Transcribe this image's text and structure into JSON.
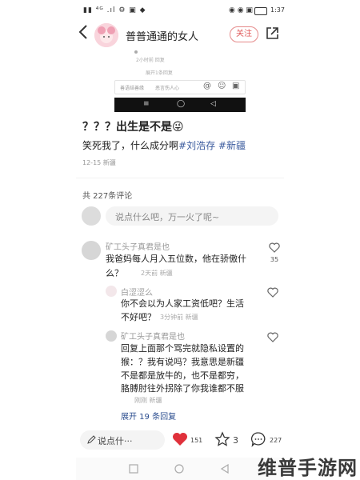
{
  "status_bar": {
    "left_icons": "▮▮ ⁴ᴳ .ıl ⚙ ▣ ◆",
    "right_icons": "◉ ◉ ▣",
    "time": "1:37"
  },
  "header": {
    "back_icon": "chevron-left",
    "username": "普普通通的女人",
    "follow_label": "关注",
    "share_icon": "share-icon"
  },
  "embedded_screenshot": {
    "meta1": "2小时前   回复",
    "meta2": "展开1条回复",
    "input_placeholder1": "善语结善缘",
    "input_placeholder2": "恶言伤人心",
    "input_icons": [
      "@",
      "☺",
      "▣"
    ],
    "nav_icons": [
      "≡",
      "◯",
      "◁"
    ]
  },
  "post": {
    "line1": "？？？出生是不是",
    "line1_emoji": "😜",
    "line2_prefix": "笑死我了，什么成分啊",
    "tags": [
      "#刘浩存",
      "#新疆"
    ],
    "date": "12-15  新疆"
  },
  "comments_count_label": "共 227条评论",
  "say_something": {
    "placeholder": "说点什么吧，万一火了呢~"
  },
  "comments": [
    {
      "name": "矿工头子真君是也",
      "text": "我爸妈每人月入五位数，他在骄傲什么？",
      "text_line2": "么？",
      "meta": "2天前  新疆",
      "likes": "35"
    }
  ],
  "replies": [
    {
      "name": "白涩涩么",
      "text_line1": "你不会以为人家工资低吧？生活",
      "text_line2": "不好吧？",
      "meta": "3分钟前  新疆"
    },
    {
      "name": "矿工头子真君是也",
      "text_line1": "回复上面那个骂完就隐私设置的",
      "text_line2": "猴：？我有说吗？我意思是新疆",
      "text_line3": "不是都是放牛的，也不是都穷，",
      "text_line4": "胳膊肘往外拐除了你我谁都不服",
      "meta": "刚刚  新疆"
    }
  ],
  "expand_label": "展开 19 条回复",
  "bottom_bar": {
    "say_label": "说点什···",
    "likes": "151",
    "stars": "3",
    "comments": "227"
  },
  "watermark": "维普手游网",
  "colors": {
    "accent_red": "#e0313b",
    "tag_blue": "#3b5b9e",
    "follow_red": "#e05a5a"
  }
}
